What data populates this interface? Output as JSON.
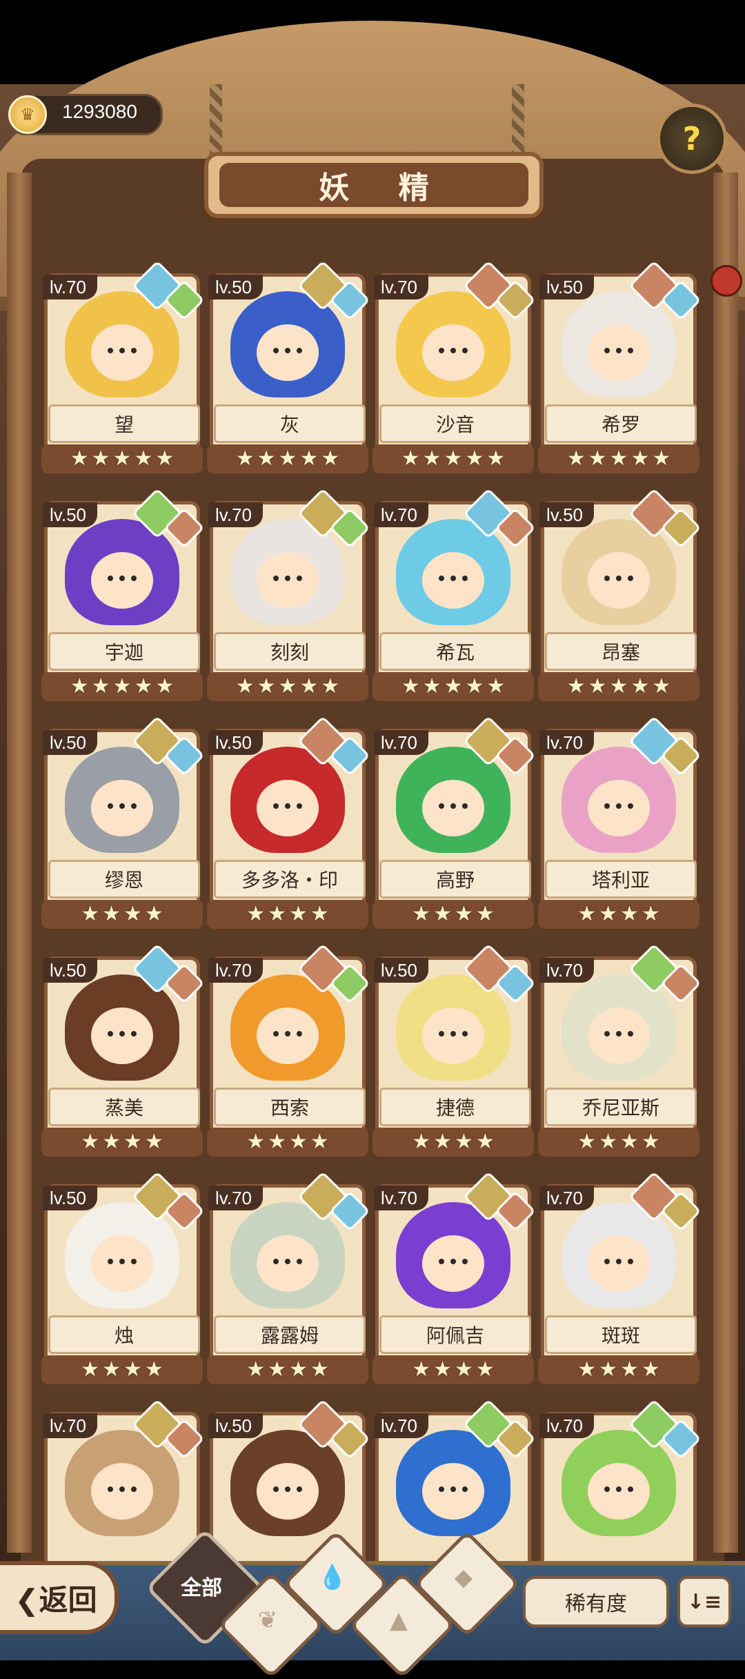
{
  "currency": {
    "amount": "1293080"
  },
  "title": "妖 精",
  "help_symbol": "?",
  "element_colors": {
    "water": "#78c4e0",
    "earth": "#c9ad5a",
    "fire": "#c98563",
    "wood": "#8ecb62"
  },
  "cards": [
    {
      "level": "lv.70",
      "name": "望",
      "stars": 5,
      "elements": [
        "water",
        "wood"
      ],
      "hair": "#f1c24a"
    },
    {
      "level": "lv.50",
      "name": "灰",
      "stars": 5,
      "elements": [
        "earth",
        "water"
      ],
      "hair": "#3b5fc9"
    },
    {
      "level": "lv.70",
      "name": "沙音",
      "stars": 5,
      "elements": [
        "fire",
        "earth"
      ],
      "hair": "#f4c84c"
    },
    {
      "level": "lv.50",
      "name": "希罗",
      "stars": 5,
      "elements": [
        "fire",
        "water"
      ],
      "hair": "#ece7e0"
    },
    {
      "level": "lv.50",
      "name": "宇迦",
      "stars": 5,
      "elements": [
        "wood",
        "fire"
      ],
      "hair": "#6d3fc4"
    },
    {
      "level": "lv.70",
      "name": "刻刻",
      "stars": 5,
      "elements": [
        "earth",
        "wood"
      ],
      "hair": "#e9e4df"
    },
    {
      "level": "lv.70",
      "name": "希瓦",
      "stars": 5,
      "elements": [
        "water",
        "fire"
      ],
      "hair": "#6dcbe6"
    },
    {
      "level": "lv.50",
      "name": "昂塞",
      "stars": 5,
      "elements": [
        "fire",
        "earth"
      ],
      "hair": "#e8cfa0"
    },
    {
      "level": "lv.50",
      "name": "缪恩",
      "stars": 4,
      "elements": [
        "earth",
        "water"
      ],
      "hair": "#9a9ea6"
    },
    {
      "level": "lv.50",
      "name": "多多洛・印",
      "stars": 4,
      "elements": [
        "fire",
        "water"
      ],
      "hair": "#c62a2a"
    },
    {
      "level": "lv.70",
      "name": "高野",
      "stars": 4,
      "elements": [
        "earth",
        "fire"
      ],
      "hair": "#3fb35a"
    },
    {
      "level": "lv.70",
      "name": "塔利亚",
      "stars": 4,
      "elements": [
        "water",
        "earth"
      ],
      "hair": "#e9a2c6"
    },
    {
      "level": "lv.50",
      "name": "蒸美",
      "stars": 4,
      "elements": [
        "water",
        "fire"
      ],
      "hair": "#6b3d25"
    },
    {
      "level": "lv.70",
      "name": "西索",
      "stars": 4,
      "elements": [
        "fire",
        "wood"
      ],
      "hair": "#f09a2b"
    },
    {
      "level": "lv.50",
      "name": "捷德",
      "stars": 4,
      "elements": [
        "fire",
        "water"
      ],
      "hair": "#f1df85"
    },
    {
      "level": "lv.70",
      "name": "乔尼亚斯",
      "stars": 4,
      "elements": [
        "wood",
        "fire"
      ],
      "hair": "#e2e2c8"
    },
    {
      "level": "lv.50",
      "name": "烛",
      "stars": 4,
      "elements": [
        "earth",
        "fire"
      ],
      "hair": "#f2f0e8"
    },
    {
      "level": "lv.70",
      "name": "露露姆",
      "stars": 4,
      "elements": [
        "earth",
        "water"
      ],
      "hair": "#c8d4c0"
    },
    {
      "level": "lv.70",
      "name": "阿佩吉",
      "stars": 4,
      "elements": [
        "earth",
        "fire"
      ],
      "hair": "#7a3fd0"
    },
    {
      "level": "lv.70",
      "name": "斑斑",
      "stars": 4,
      "elements": [
        "fire",
        "earth"
      ],
      "hair": "#e8e8e8"
    },
    {
      "level": "lv.70",
      "name": "",
      "stars": 0,
      "elements": [
        "earth",
        "fire"
      ],
      "hair": "#c7a074"
    },
    {
      "level": "lv.50",
      "name": "",
      "stars": 0,
      "elements": [
        "fire",
        "earth"
      ],
      "hair": "#6a4028"
    },
    {
      "level": "lv.70",
      "name": "",
      "stars": 0,
      "elements": [
        "wood",
        "earth"
      ],
      "hair": "#2f6fd0"
    },
    {
      "level": "lv.70",
      "name": "",
      "stars": 0,
      "elements": [
        "wood",
        "water"
      ],
      "hair": "#8fcf5a"
    }
  ],
  "bottom": {
    "back_label": "❮返回",
    "filter_all_label": "全部",
    "sort_label": "稀有度",
    "order_icon": "↓≡"
  }
}
